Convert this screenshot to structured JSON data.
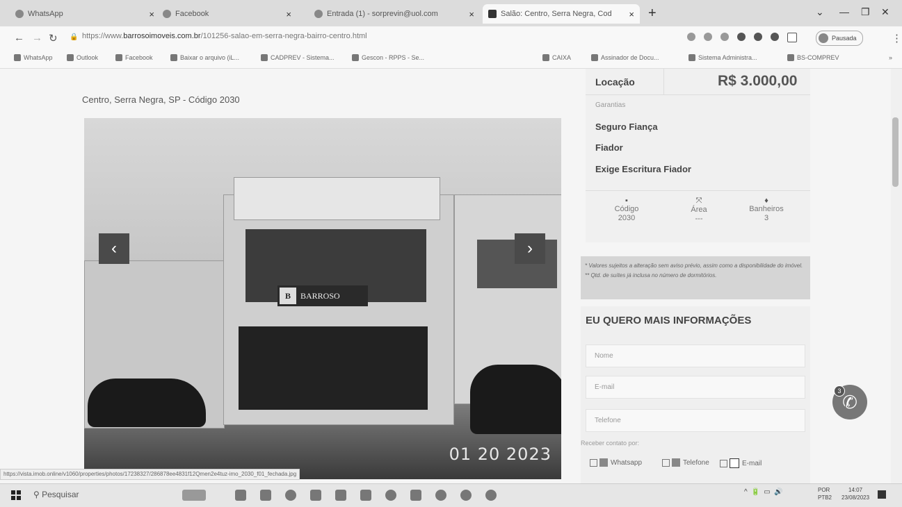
{
  "browser": {
    "tabs": [
      {
        "title": "WhatsApp",
        "active": false
      },
      {
        "title": "Facebook",
        "active": false
      },
      {
        "title": "Entrada (1) - sorprevin@uol.com",
        "active": false
      },
      {
        "title": "Salão: Centro, Serra Negra, Cod",
        "active": true
      }
    ],
    "new_tab": "+",
    "url_prefix": "https://www.",
    "url_domain": "barrosoimoveis.com.br",
    "url_path": "/101256-salao-em-serra-negra-bairro-centro.html",
    "profile_label": "Pausada",
    "bookmarks": [
      "WhatsApp",
      "Outlook",
      "Facebook",
      "Baixar o arquivo (iL...",
      "CADPREV - Sistema...",
      "Gescon - RPPS - Se...",
      "CAIXA",
      "Assinador de Docu...",
      "Sistema Administra...",
      "BS-COMPREV"
    ]
  },
  "listing": {
    "location": "Centro, Serra Negra, SP - Código 2030",
    "photo": {
      "sign_text": "BARROSO",
      "date_stamp": "01 20 2023",
      "prev_label": "‹",
      "next_label": "›"
    },
    "price_label": "Locação",
    "price_value": "R$ 3.000,00",
    "guarantees_title": "Garantias",
    "guarantees": [
      "Seguro Fiança",
      "Fiador",
      "Exige Escritura Fiador"
    ],
    "stats": [
      {
        "icon": "tag-icon",
        "label": "Código",
        "value": "2030"
      },
      {
        "icon": "area-icon",
        "label": "Área",
        "value": "---"
      },
      {
        "icon": "bath-icon",
        "label": "Banheiros",
        "value": "3"
      }
    ],
    "disclaimer": "* Valores sujeitos a alteração sem aviso prévio, assim como a disponibilidade do imóvel. ** Qtd. de suítes já inclusa no número de dormitórios."
  },
  "form": {
    "title": "EU QUERO MAIS INFORMAÇÕES",
    "name_placeholder": "Nome",
    "email_placeholder": "E-mail",
    "phone_placeholder": "Telefone",
    "contact_label": "Receber contato por:",
    "options": [
      "Whatsapp",
      "Telefone",
      "E-mail"
    ]
  },
  "chat": {
    "badge": "3",
    "icon": "whatsapp-icon"
  },
  "status_url": "https://vista.imob.online/v1060/properties/photos/17238327/286878ee4831f12Qmen2e4tuz-imo_2030_f01_fechada.jpg",
  "taskbar": {
    "search_label": "Pesquisar",
    "lang": [
      "POR",
      "PTB2"
    ],
    "time": "14:07",
    "date": "23/08/2023"
  }
}
